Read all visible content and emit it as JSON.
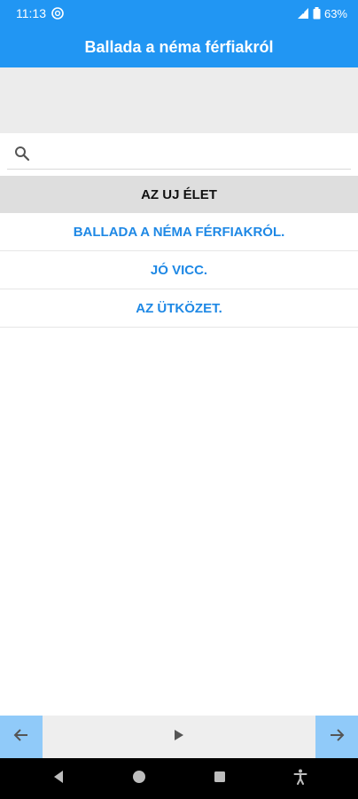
{
  "status_bar": {
    "time": "11:13",
    "battery": "63%"
  },
  "app_bar": {
    "title": "Ballada a néma férfiakról"
  },
  "search": {
    "placeholder": "",
    "value": ""
  },
  "list": {
    "header": "AZ UJ ÉLET",
    "items": [
      {
        "label": "BALLADA A NÉMA FÉRFIAKRÓL."
      },
      {
        "label": "JÓ VICC."
      },
      {
        "label": "AZ ÜTKÖZET."
      }
    ]
  },
  "bottom_nav": {
    "prev_icon": "arrow-left-icon",
    "play_icon": "play-icon",
    "next_icon": "arrow-right-icon"
  },
  "colors": {
    "primary": "#2196F3",
    "link": "#1e88e5",
    "nav_button": "#90caf9"
  }
}
